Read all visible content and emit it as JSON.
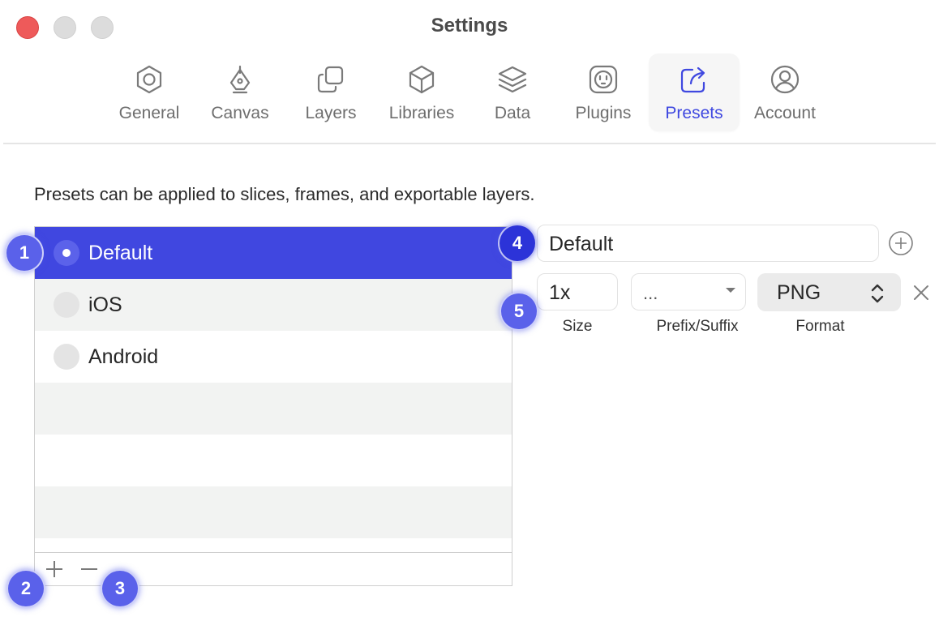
{
  "window": {
    "title": "Settings"
  },
  "tabs": [
    {
      "label": "General",
      "icon": "hexagon-gear-icon"
    },
    {
      "label": "Canvas",
      "icon": "pen-nib-icon"
    },
    {
      "label": "Layers",
      "icon": "layers-squares-icon"
    },
    {
      "label": "Libraries",
      "icon": "cube-icon"
    },
    {
      "label": "Data",
      "icon": "stack-icon"
    },
    {
      "label": "Plugins",
      "icon": "plug-socket-icon"
    },
    {
      "label": "Presets",
      "icon": "share-export-icon",
      "active": true
    },
    {
      "label": "Account",
      "icon": "user-circle-icon"
    }
  ],
  "description": "Presets can be applied to slices, frames, and exportable layers.",
  "presets": {
    "items": [
      {
        "label": "Default",
        "selected": true
      },
      {
        "label": "iOS",
        "selected": false
      },
      {
        "label": "Android",
        "selected": false
      }
    ],
    "add_symbol": "+",
    "remove_symbol": "—"
  },
  "editor": {
    "name_value": "Default",
    "size_value": "1x",
    "prefix_value": "...",
    "format_value": "PNG",
    "size_label": "Size",
    "prefix_label": "Prefix/Suffix",
    "format_label": "Format"
  },
  "markers": [
    "1",
    "2",
    "3",
    "4",
    "5"
  ],
  "colors": {
    "accent": "#3f48e0",
    "selection": "#4047e0",
    "marker": "#5a61ea",
    "close": "#ee5a5a"
  }
}
